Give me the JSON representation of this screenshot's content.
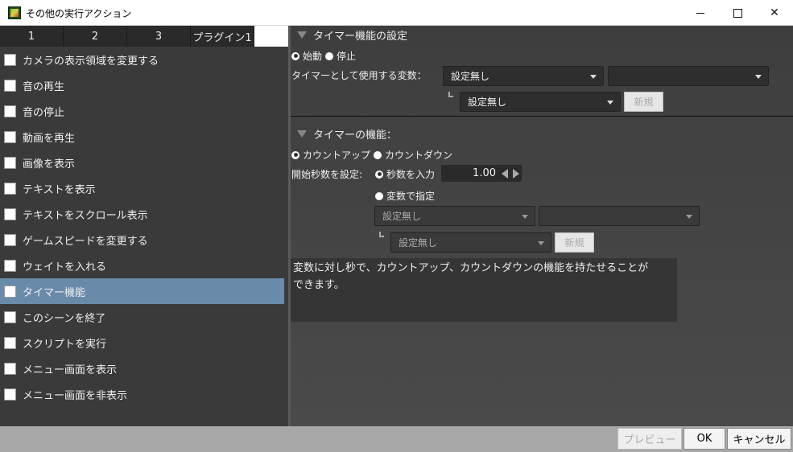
{
  "window": {
    "title": "その他の実行アクション"
  },
  "tabs": [
    "1",
    "2",
    "3",
    "プラグイン1"
  ],
  "actions": [
    "カメラの表示領域を変更する",
    "音の再生",
    "音の停止",
    "動画を再生",
    "画像を表示",
    "テキストを表示",
    "テキストをスクロール表示",
    "ゲームスピードを変更する",
    "ウェイトを入れる",
    "タイマー機能",
    "このシーンを終了",
    "スクリプトを実行",
    "メニュー画面を表示",
    "メニュー画面を非表示"
  ],
  "selected_action": "タイマー機能",
  "timer_settings": {
    "heading": "タイマー機能の設定",
    "start_label": "始動",
    "stop_label": "停止",
    "selected_mode": "始動",
    "variable_label": "タイマーとして使用する変数：",
    "variable_select": "設定無し",
    "variable_sub_select": "",
    "variable_sub2_select": "設定無し",
    "new_button": "新規"
  },
  "timer_function": {
    "heading": "タイマーの機能：",
    "countup_label": "カウントアップ",
    "countdown_label": "カウントダウン",
    "selected_direction": "カウントアップ",
    "start_seconds_label": "開始秒数を設定:",
    "input_seconds_label": "秒数を入力",
    "seconds_value": "1.00",
    "by_variable_label": "変数で指定",
    "var_select": "設定無し",
    "var_sub_select": "",
    "var_sub2_select": "設定無し",
    "new_button": "新規"
  },
  "description": {
    "line1": "変数に対し秒で、カウントアップ、カウントダウンの機能を持たせることが",
    "line2": "できます。"
  },
  "footer": {
    "preview": "プレビュー",
    "ok": "OK",
    "cancel": "キャンセル"
  }
}
